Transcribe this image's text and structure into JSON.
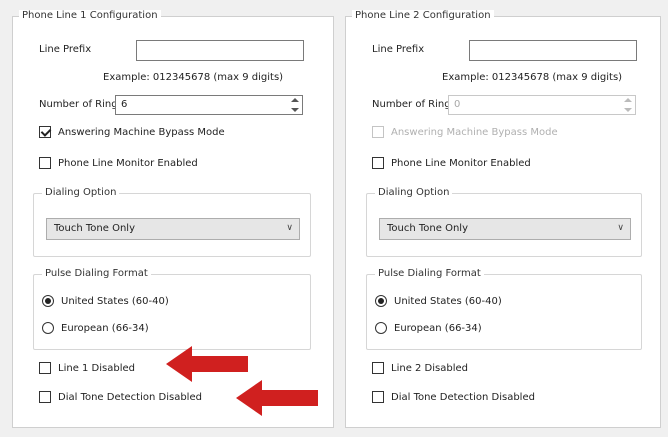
{
  "line1": {
    "title": "Phone Line 1 Configuration",
    "line_prefix_label": "Line Prefix",
    "line_prefix_value": "",
    "example_text": "Example: 012345678 (max 9 digits)",
    "rings_label": "Number of Rings",
    "rings_value": "6",
    "answering_bypass_label": "Answering Machine Bypass Mode",
    "answering_bypass_checked": true,
    "monitor_label": "Phone Line Monitor Enabled",
    "dialing_option_title": "Dialing Option",
    "dialing_option_value": "Touch Tone Only",
    "pulse_format_title": "Pulse Dialing Format",
    "pulse_us_label": "United States (60-40)",
    "pulse_eu_label": "European (66-34)",
    "line_disabled_label": "Line 1 Disabled",
    "dial_tone_label": "Dial Tone Detection Disabled"
  },
  "line2": {
    "title": "Phone Line 2 Configuration",
    "line_prefix_label": "Line Prefix",
    "line_prefix_value": "",
    "example_text": "Example: 012345678 (max 9 digits)",
    "rings_label": "Number of Rings",
    "rings_value": "0",
    "answering_bypass_label": "Answering Machine Bypass Mode",
    "answering_bypass_checked": false,
    "monitor_label": "Phone Line Monitor Enabled",
    "dialing_option_title": "Dialing Option",
    "dialing_option_value": "Touch Tone Only",
    "pulse_format_title": "Pulse Dialing Format",
    "pulse_us_label": "United States (60-40)",
    "pulse_eu_label": "European (66-34)",
    "line_disabled_label": "Line 2 Disabled",
    "dial_tone_label": "Dial Tone Detection Disabled"
  },
  "annotation_color": "#d0201f"
}
